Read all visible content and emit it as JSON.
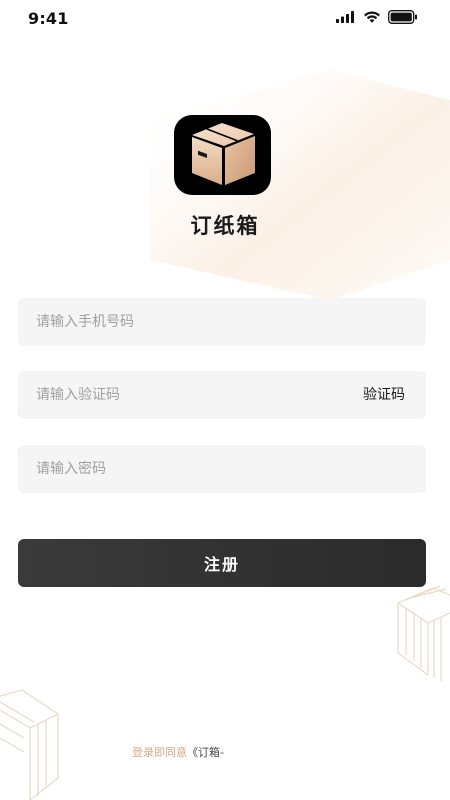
{
  "status_bar": {
    "time": "9:41",
    "icons": [
      "signal-icon",
      "wifi-icon",
      "battery-icon"
    ]
  },
  "app": {
    "name": "订纸箱",
    "logo_icon": "box-icon"
  },
  "form": {
    "phone_placeholder": "请输入手机号码",
    "code_placeholder": "请输入验证码",
    "code_button": "验证码",
    "password_placeholder": "请输入密码",
    "submit_label": "注册"
  },
  "agreement": {
    "prefix": "登录即同意",
    "link": "《订箱-"
  },
  "colors": {
    "accent_text": "#d9a882",
    "button_bg": "#333333",
    "field_bg": "#f5f5f5",
    "logo_gradient_light": "#f5dcc4",
    "logo_gradient_dark": "#d1a27d"
  }
}
